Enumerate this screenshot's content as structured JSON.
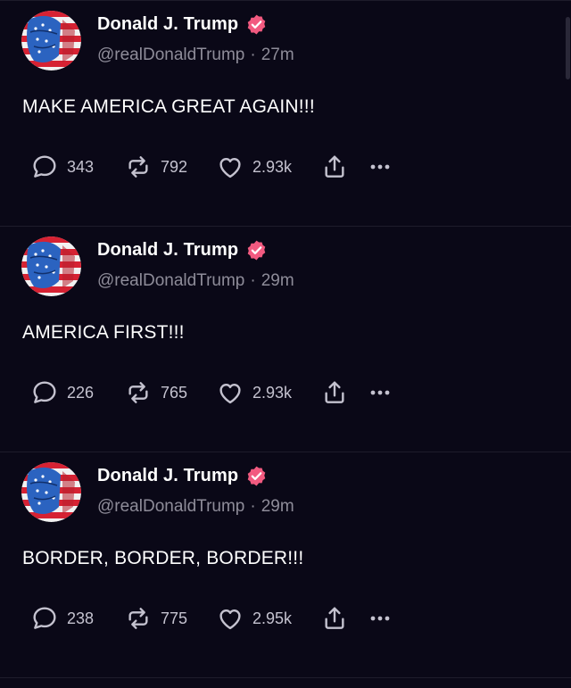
{
  "theme": {
    "background": "#0a0817",
    "divider": "#1e1c2b",
    "muted_text": "#8e8c99",
    "action_icon": "#c4c2cf",
    "verified_badge": "#f25a80"
  },
  "posts": [
    {
      "author": "Donald J. Trump",
      "handle": "@realDonaldTrump",
      "time": "27m",
      "text": "MAKE AMERICA GREAT AGAIN!!!",
      "replies": "343",
      "reposts": "792",
      "likes": "2.93k"
    },
    {
      "author": "Donald J. Trump",
      "handle": "@realDonaldTrump",
      "time": "29m",
      "text": "AMERICA FIRST!!!",
      "replies": "226",
      "reposts": "765",
      "likes": "2.93k"
    },
    {
      "author": "Donald J. Trump",
      "handle": "@realDonaldTrump",
      "time": "29m",
      "text": "BORDER, BORDER, BORDER!!!",
      "replies": "238",
      "reposts": "775",
      "likes": "2.95k"
    }
  ],
  "separator": "·"
}
